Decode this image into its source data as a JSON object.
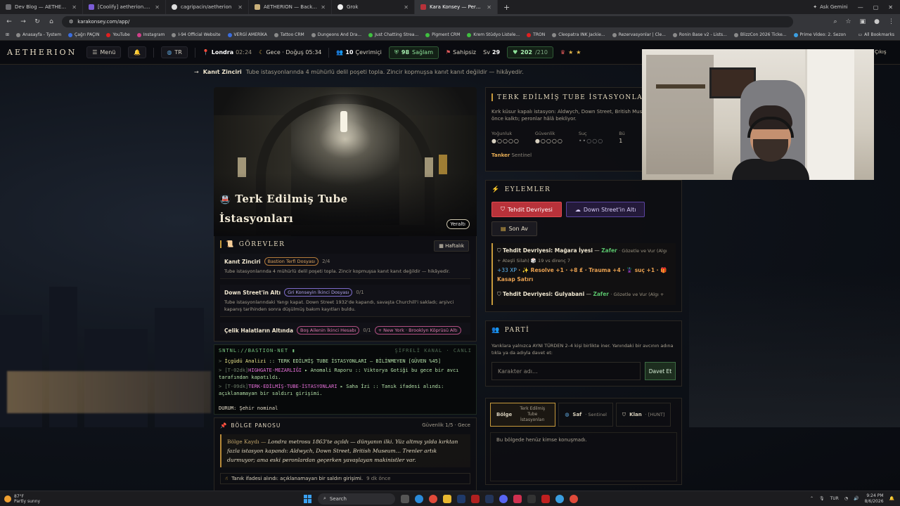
{
  "browser": {
    "tabs": [
      {
        "label": "Dev Blog — AETHERION",
        "active": false
      },
      {
        "label": "[Coolify] aetherion.s - Deploy",
        "active": false
      },
      {
        "label": "cagripacin/aetherion",
        "active": false
      },
      {
        "label": "AETHERION — Backoffice",
        "active": false
      },
      {
        "label": "Grok",
        "active": false
      },
      {
        "label": "Kara Konsey — Perde Aralanıyor",
        "active": true
      }
    ],
    "gemini_label": "Ask Gemini",
    "url": "karakonsey.com/app/",
    "bookmarks": [
      "Anasayfa - Tystem",
      "Çağrı PAÇIN",
      "YouTube",
      "Instagram",
      "I-94 Official Website",
      "VERGİ AMERİKA",
      "Tattoo CRM",
      "Dungeons And Dra...",
      "Just Chatting Strea...",
      "Pigment CRM",
      "Krem Stüdyo Listele...",
      "TRON",
      "Cleopatra INK Jackie...",
      "Rezervasyonlar | Cle...",
      "Ronin Base v2 - Lists...",
      "BlizzCon 2026 Ticke...",
      "Prime Video: 2. Sezon"
    ],
    "all_bookmarks": "All Bookmarks"
  },
  "nav": {
    "brand": "AETHERION",
    "menu": "Menü",
    "lang": "TR",
    "city": "Londra",
    "city_time": "02:24",
    "phase": "Gece · Doğuş 05:34",
    "online_count": "10",
    "online_label": "Çevrimiçi",
    "health_val": "98",
    "health_label": "Sağlam",
    "owner": "Sahipsiz",
    "level_label": "Sv",
    "level": "29",
    "hp": "202",
    "hp_max": "/210",
    "right_label": "Çıkış"
  },
  "crumb": {
    "title": "Kanıt Zinciri",
    "desc": "Tube istasyonlarında 4 mühürlü delil poşeti topla. Zincir kopmuşsa kanıt kanıt değildir — hikâyedir."
  },
  "hero": {
    "title": "Terk Edilmiş Tube İstasyonları",
    "badge": "Yeraltı"
  },
  "quests": {
    "heading": "GÖREVLER",
    "weekly": "Haftalık",
    "items": [
      {
        "title": "Kanıt Zinciri",
        "tag": "Bastion Terfi Dosyası",
        "count": "2/4",
        "desc": "Tube istasyonlarında 4 mühürlü delil poşeti topla. Zincir kopmuşsa kanıt kanıt değildir — hikâyedir."
      },
      {
        "title": "Down Street'in Altı",
        "tag": "Gri Konseyin İkinci Dosyası",
        "count": "0/1",
        "desc": "Tube istasyonlarındaki Yangı kapat. Down Street 1932'de kapandı, savaşta Churchill'i sakladı; arşivci kapanış tarihinden sonra düşülmüş bakım kayıtları buldu."
      },
      {
        "title": "Çelik Halatların Altında",
        "tag": "Boş Ailenin İkinci Hesabı",
        "count": "0/1",
        "extra": "New York · Brooklyn Köprüsü Altı"
      }
    ]
  },
  "terminal": {
    "head": "SNTNL://BASTION-NET ▮",
    "head_right": "ŞİFRELİ KANAL · CANLI",
    "lines": [
      {
        "pre": "> ",
        "a": "İçgüdü Analizi",
        "b": " :: TERK EDİLMİŞ TUBE İSTASYONLARI — BİLİNMEYEN [GÜVEN %45]"
      },
      {
        "pre": "> [T-02dk]",
        "a": "HIGHGATE-MEZARLIĞI",
        "b": " ▸ Anomali Raporu :: Viktorya Gotiği bu gece bir avcı tarafından kapatıldı."
      },
      {
        "pre": "> [T-09dk]",
        "a": "TERK-EDİLMİŞ-TUBE-İSTASYONLARI",
        "b": " ▸ Saha İzi :: Tanık ifadesi alındı: açıklanamayan bir saldırı girişimi."
      }
    ],
    "status": "DURUM: Şehir nominal"
  },
  "region": {
    "heading": "BÖLGE PANOSU",
    "security": "Güvenlik 1/5 · Gece",
    "label": "Bölge Kaydı —",
    "quote": "Londra metrosu 1863'te açıldı — dünyanın ilki. Yüz altmış yılda kırktan fazla istasyon kapandı: Aldwych, Down Street, British Museum… Trenler artık durmuyor; ama eski peronlardan geçerken yavaşlayan makinistler var.",
    "footer": "Tanık ifadesi alındı: açıklanamayan bir saldırı girişimi.",
    "footer_time": "9 dk önce"
  },
  "station": {
    "heading": "TERK EDİLMİŞ TUBE İSTASYONLARI",
    "desc": "Kırk küsur kapalı istasyon: Aldwych, Down Street, British Museum… elli yıl önce kalktı; peronlar hâlâ bekliyor.",
    "stats": [
      {
        "label": "Yoğunluk",
        "dots": "●○○○○"
      },
      {
        "label": "Güvenlik",
        "dots": "●○○○○"
      },
      {
        "label": "Suç",
        "dots": "••○○○"
      },
      {
        "label": "Bü",
        "dots": "1"
      }
    ],
    "tanker": "Tanker",
    "tanker_role": "Sentinel"
  },
  "actions": {
    "heading": "EYLEMLER",
    "buttons": [
      "Tehdit Devriyesi",
      "Down Street'in Altı",
      "Son Av"
    ],
    "log": [
      {
        "title": "Tehdit Devriyesi: Mağara İyesi",
        "result": "Zafer",
        "meta": "· Gözetle ve Vur (Algı + Ateşli Silah) 🎲 19 vs direnç 7",
        "reward_xp": "+33 XP",
        "reward": "· ✨ Resolve +1 · +8 ₤ · Trauma +4 · 🦹 suç +1 · 🎁 Kasap Satırı"
      },
      {
        "title": "Tehdit Devriyesi: Gulyabani",
        "result": "Zafer",
        "meta": "· Gözetle ve Vur (Algı +"
      }
    ]
  },
  "party": {
    "heading": "PARTİ",
    "desc": "Yarıklara yalnızca AYNI TÜRDEN 2–4 kişi birlikte iner. Yanındaki bir avcının adına tıkla ya da adıyla davet et:",
    "placeholder": "Karakter adı…",
    "invite": "Davet Et"
  },
  "chat": {
    "tabs": [
      {
        "label": "Bölge",
        "sub": "Terk Edilmiş Tube İstasyonları"
      },
      {
        "label": "Saf",
        "sub": "· Sentinel"
      },
      {
        "label": "Klan",
        "sub": "· [HUNT]"
      }
    ],
    "empty": "Bu bölgede henüz kimse konuşmadı."
  },
  "taskbar": {
    "temp": "87°F",
    "weather": "Partly sunny",
    "search": "Search",
    "lang": "TUR",
    "time": "9:24 PM",
    "date": "8/6/2026"
  }
}
